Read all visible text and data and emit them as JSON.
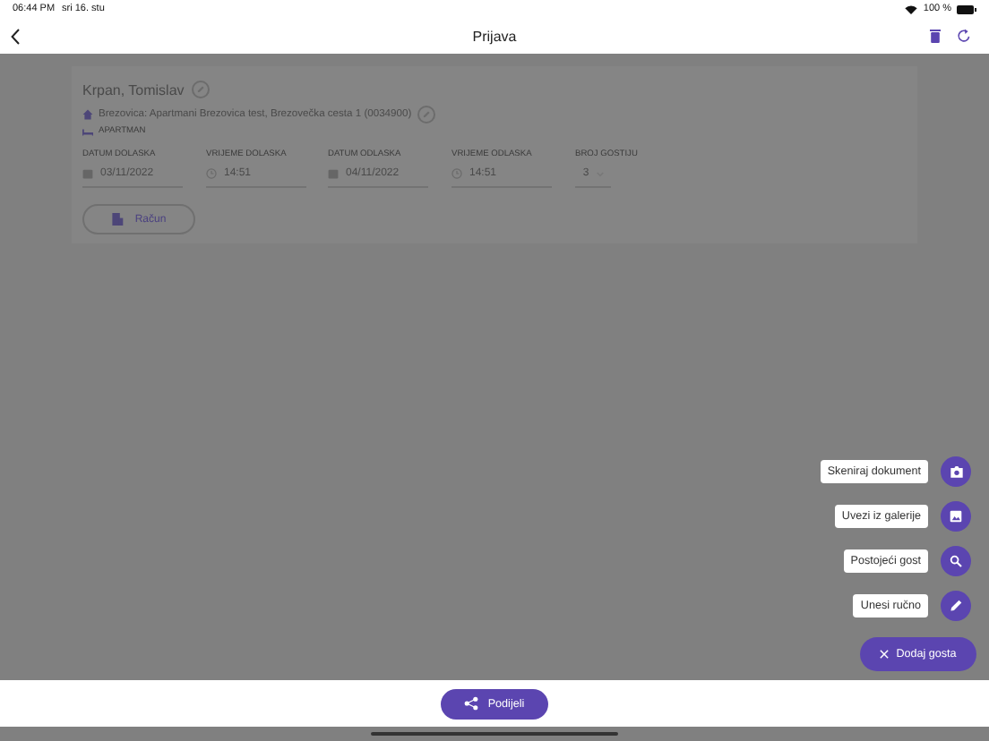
{
  "status_bar": {
    "time": "06:44 PM",
    "date": "sri 16. stu",
    "battery": "100 %"
  },
  "nav": {
    "title": "Prijava"
  },
  "guest": {
    "name": "Krpan, Tomislav",
    "property": "Brezovica: Apartmani Brezovica test, Brezovečka cesta 1 (0034900)",
    "unit": "APARTMAN",
    "fields": [
      {
        "label": "DATUM DOLASKA",
        "value": "03/11/2022",
        "kind": "date"
      },
      {
        "label": "VRIJEME DOLASKA",
        "value": "14:51",
        "kind": "time"
      },
      {
        "label": "DATUM ODLASKA",
        "value": "04/11/2022",
        "kind": "date"
      },
      {
        "label": "VRIJEME ODLASKA",
        "value": "14:51",
        "kind": "time"
      },
      {
        "label": "BROJ GOSTIJU",
        "value": "3",
        "kind": "select"
      }
    ],
    "invoice_button": "Račun"
  },
  "fab_menu": {
    "items": [
      {
        "label": "Skeniraj dokument",
        "kind": "camera"
      },
      {
        "label": "Uvezi iz galerije",
        "kind": "gallery"
      },
      {
        "label": "Postojeći gost",
        "kind": "search"
      },
      {
        "label": "Unesi ručno",
        "kind": "edit"
      }
    ],
    "main": "Dodaj gosta"
  },
  "share_button": "Podijeli"
}
